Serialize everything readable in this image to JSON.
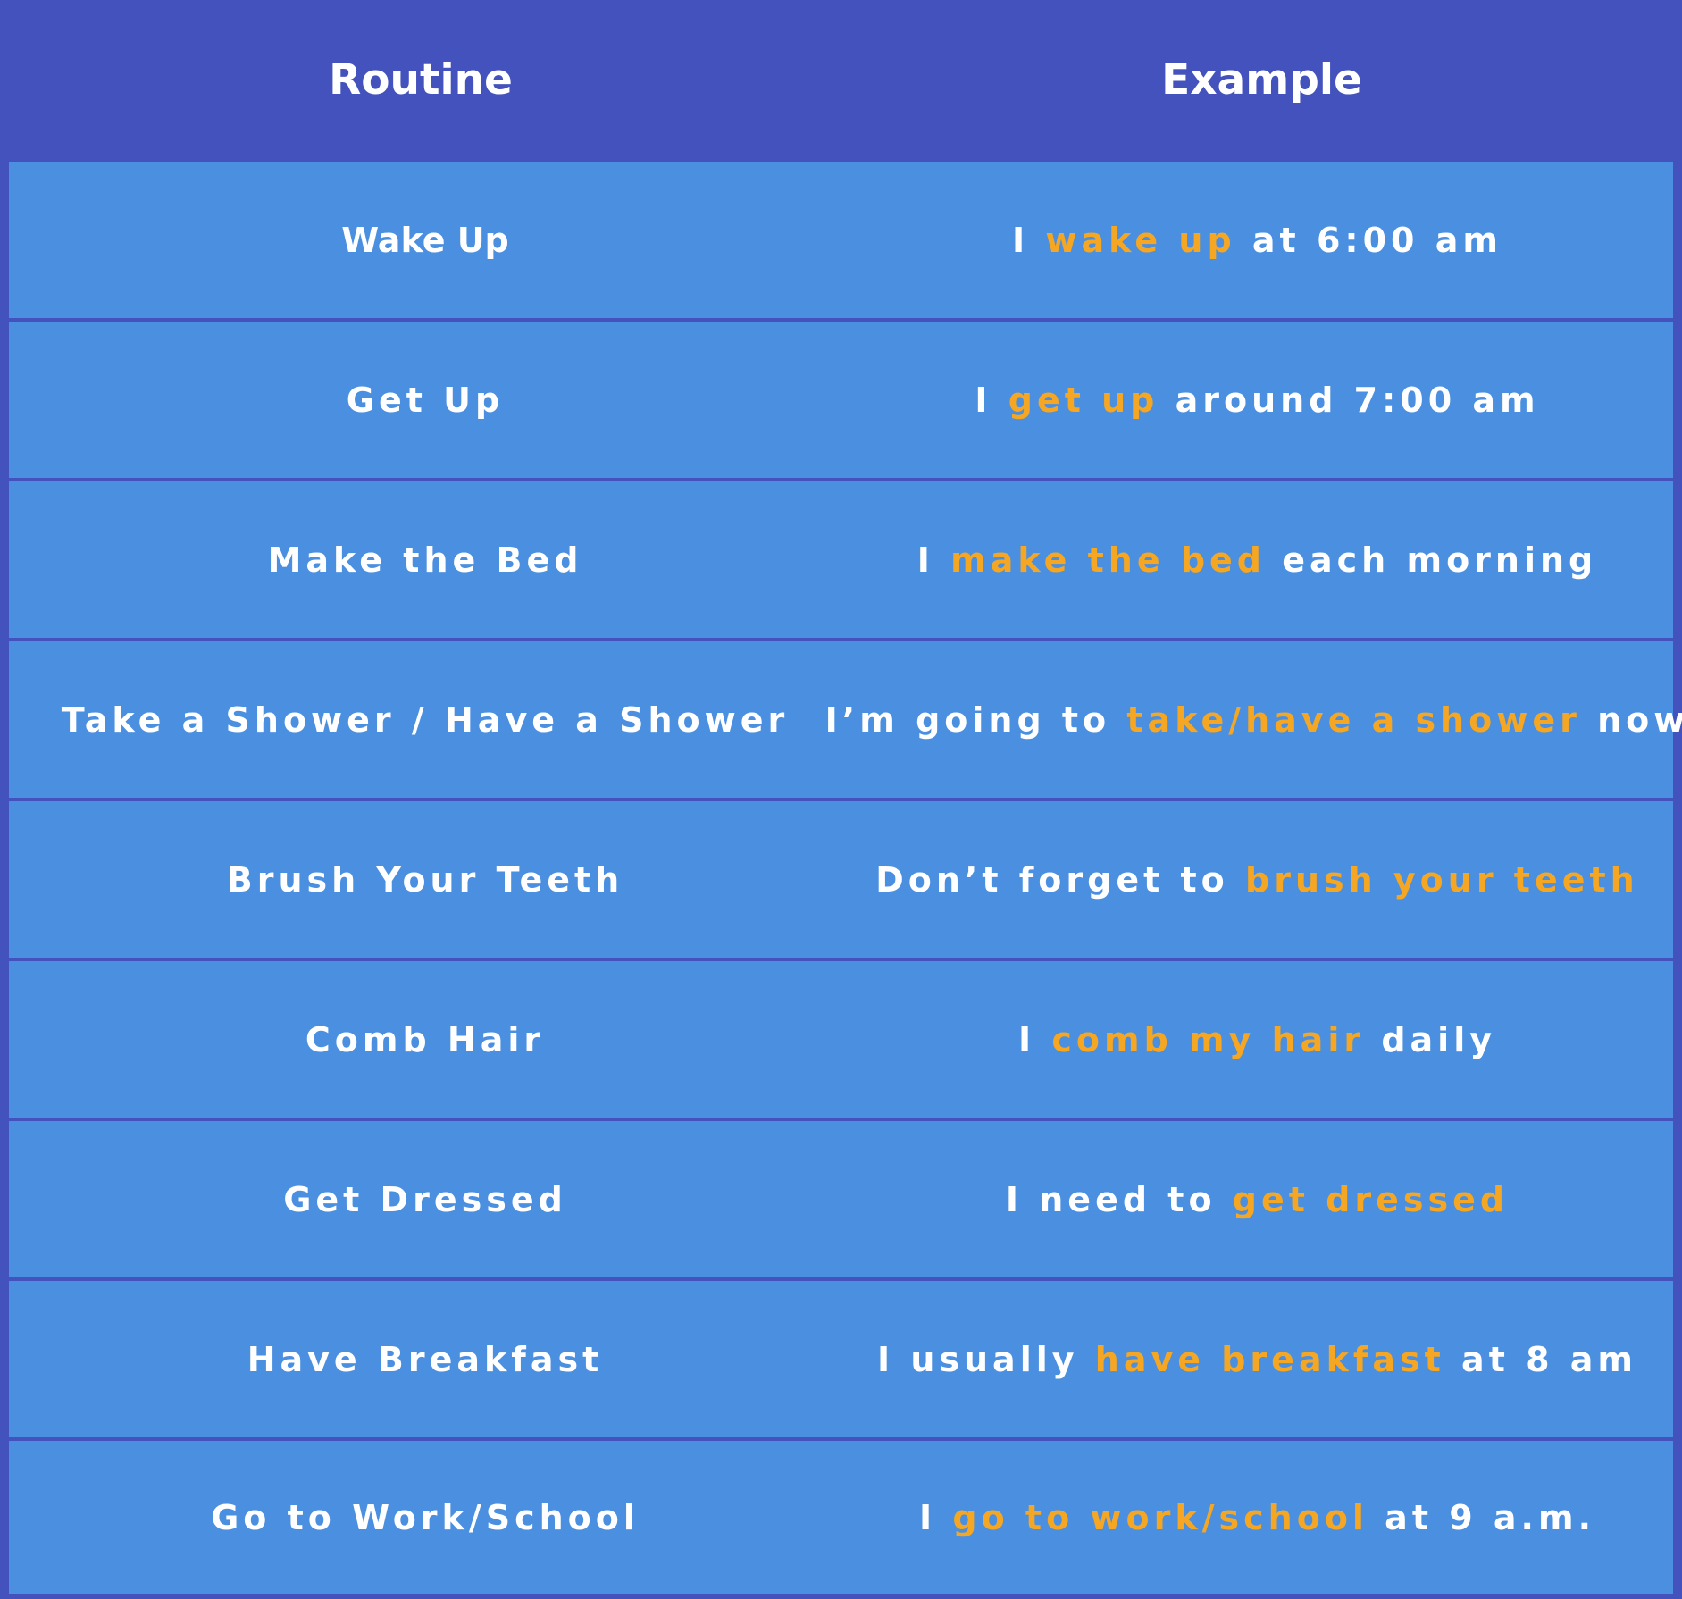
{
  "colors": {
    "header_bg": "#4352bc",
    "row_bg": "#4a8fe0",
    "text": "#ffffff",
    "highlight": "#f5a623"
  },
  "header": {
    "routine": "Routine",
    "example": "Example"
  },
  "rows": [
    {
      "routine": "Wake Up",
      "example": {
        "before": "I ",
        "highlight": "wake up",
        "after": " at 6:00 am"
      }
    },
    {
      "routine": "Get Up",
      "example": {
        "before": "I ",
        "highlight": "get up",
        "after": " around 7:00 am"
      }
    },
    {
      "routine": "Make the Bed",
      "example": {
        "before": "I ",
        "highlight": "make the bed",
        "after": " each morning"
      }
    },
    {
      "routine": "Take a Shower / Have a Shower",
      "example": {
        "before": "I’m going to ",
        "highlight": "take/have a shower",
        "after": " now"
      }
    },
    {
      "routine": "Brush Your Teeth",
      "example": {
        "before": "Don’t forget to ",
        "highlight": "brush your teeth",
        "after": ""
      }
    },
    {
      "routine": "Comb Hair",
      "example": {
        "before": "I ",
        "highlight": "comb my hair",
        "after": " daily"
      }
    },
    {
      "routine": "Get Dressed",
      "example": {
        "before": "I need to ",
        "highlight": "get dressed",
        "after": ""
      }
    },
    {
      "routine": "Have Breakfast",
      "example": {
        "before": "I usually ",
        "highlight": "have breakfast",
        "after": " at 8 am"
      }
    },
    {
      "routine": "Go to Work/School",
      "example": {
        "before": "I ",
        "highlight": "go to work/school",
        "after": " at 9 a.m."
      }
    }
  ]
}
